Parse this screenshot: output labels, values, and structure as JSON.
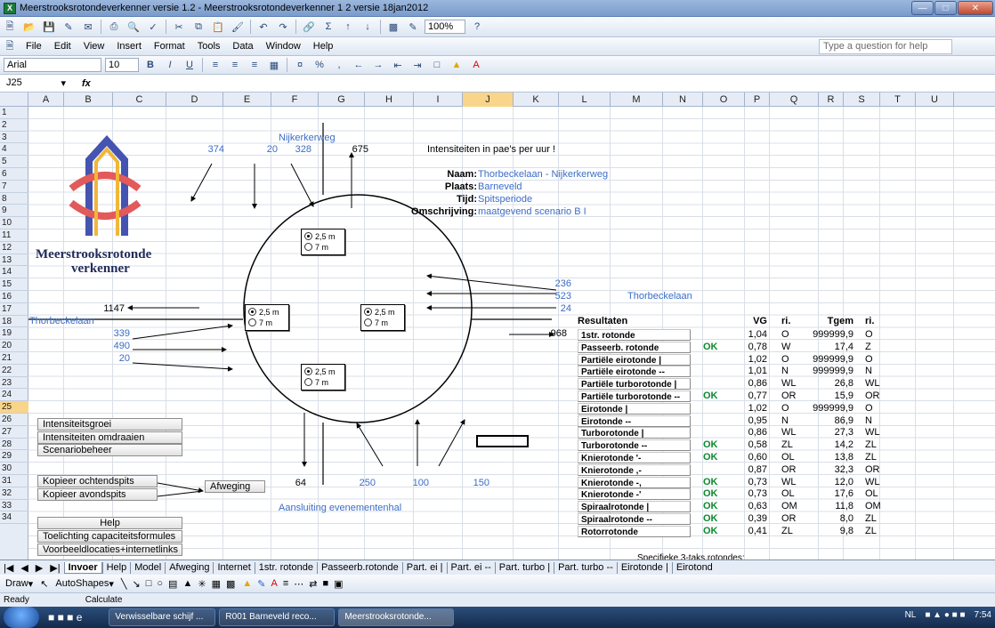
{
  "window": {
    "title": "Meerstrooksrotondeverkenner versie 1.2 - Meerstrooksrotondeverkenner 1 2 versie 18jan2012",
    "app_icon": "X"
  },
  "toolbar": {
    "zoom": "100%"
  },
  "menu": {
    "items": [
      "File",
      "Edit",
      "View",
      "Insert",
      "Format",
      "Tools",
      "Data",
      "Window",
      "Help"
    ],
    "help_placeholder": "Type a question for help"
  },
  "format": {
    "font": "Arial",
    "size": "10"
  },
  "formula": {
    "cell": "J25",
    "fx": "fx",
    "value": ""
  },
  "columns": [
    "A",
    "B",
    "C",
    "D",
    "E",
    "F",
    "G",
    "H",
    "I",
    "J",
    "K",
    "L",
    "M",
    "N",
    "O",
    "P",
    "Q",
    "R",
    "S",
    "T",
    "U"
  ],
  "rows": [
    "1",
    "2",
    "3",
    "4",
    "5",
    "6",
    "7",
    "8",
    "9",
    "10",
    "11",
    "12",
    "13",
    "14",
    "15",
    "16",
    "17",
    "18",
    "19",
    "20",
    "21",
    "22",
    "23",
    "24",
    "25",
    "26",
    "27",
    "28",
    "29",
    "30",
    "31",
    "32",
    "33",
    "34"
  ],
  "logo": {
    "line1": "Meerstrooksrotonde",
    "line2": "verkenner"
  },
  "north": {
    "road": "Nijkerkerweg",
    "v1": "374",
    "v2": "20",
    "v3": "328",
    "v4": "675"
  },
  "info": {
    "header": "Intensiteiten in pae's per uur !",
    "naam_label": "Naam:",
    "naam": "Thorbeckelaan - Nijkerkerweg",
    "plaats_label": "Plaats:",
    "plaats": "Barneveld",
    "tijd_label": "Tijd:",
    "tijd": "Spitsperiode",
    "omschr_label": "Omschrijving:",
    "omschr": "maatgevend scenario B I"
  },
  "east": {
    "road": "Thorbeckelaan",
    "v1": "236",
    "v2": "523",
    "v3": "24",
    "out": "968"
  },
  "west": {
    "road": "Thorbeckelaan",
    "out": "1147",
    "v1": "339",
    "v2": "490",
    "v3": "20"
  },
  "south": {
    "road": "Aansluiting evenementenhal",
    "out": "64",
    "v1": "250",
    "v2": "100",
    "v3": "150"
  },
  "radio": {
    "a": "2,5 m",
    "b": "7 m"
  },
  "buttons": {
    "groei": "Intensiteitsgroei",
    "omdraaien": "Intensiteiten omdraaien",
    "scenario": "Scenariobeheer",
    "ochtend": "Kopieer ochtendspits",
    "avond": "Kopieer avondspits",
    "afweging": "Afweging",
    "help": "Help",
    "toelichting": "Toelichting capaciteitsformules",
    "voorbeeld": "Voorbeeldlocaties+internetlinks"
  },
  "results": {
    "title": "Resultaten",
    "vg_hdr": "VG",
    "ri_hdr": "ri.",
    "tgem_hdr": "Tgem",
    "ri2_hdr": "ri.",
    "footer": "Specifieke 3-taks rotondes:",
    "rows": [
      {
        "name": "1str. rotonde",
        "ok": "",
        "vg": "1,04",
        "ri": "O",
        "tgem": "999999,9",
        "ri2": "O"
      },
      {
        "name": "Passeerb. rotonde",
        "ok": "OK",
        "vg": "0,78",
        "ri": "W",
        "tgem": "17,4",
        "ri2": "Z"
      },
      {
        "name": "Partiële eirotonde |",
        "ok": "",
        "vg": "1,02",
        "ri": "O",
        "tgem": "999999,9",
        "ri2": "O"
      },
      {
        "name": "Partiële eirotonde --",
        "ok": "",
        "vg": "1,01",
        "ri": "N",
        "tgem": "999999,9",
        "ri2": "N"
      },
      {
        "name": "Partiële turborotonde |",
        "ok": "",
        "vg": "0,86",
        "ri": "WL",
        "tgem": "26,8",
        "ri2": "WL"
      },
      {
        "name": "Partiële turborotonde --",
        "ok": "OK",
        "vg": "0,77",
        "ri": "OR",
        "tgem": "15,9",
        "ri2": "OR"
      },
      {
        "name": "Eirotonde       |",
        "ok": "",
        "vg": "1,02",
        "ri": "O",
        "tgem": "999999,9",
        "ri2": "O"
      },
      {
        "name": "Eirotonde       --",
        "ok": "",
        "vg": "0,95",
        "ri": "N",
        "tgem": "86,9",
        "ri2": "N"
      },
      {
        "name": "Turborotonde |",
        "ok": "",
        "vg": "0,86",
        "ri": "WL",
        "tgem": "27,3",
        "ri2": "WL"
      },
      {
        "name": "Turborotonde --",
        "ok": "OK",
        "vg": "0,58",
        "ri": "ZL",
        "tgem": "14,2",
        "ri2": "ZL"
      },
      {
        "name": "Knierotonde   '-",
        "ok": "OK",
        "vg": "0,60",
        "ri": "OL",
        "tgem": "13,8",
        "ri2": "ZL"
      },
      {
        "name": "Knierotonde   ,-",
        "ok": "",
        "vg": "0,87",
        "ri": "OR",
        "tgem": "32,3",
        "ri2": "OR"
      },
      {
        "name": "Knierotonde   -,",
        "ok": "OK",
        "vg": "0,73",
        "ri": "WL",
        "tgem": "12,0",
        "ri2": "WL"
      },
      {
        "name": "Knierotonde   -'",
        "ok": "OK",
        "vg": "0,73",
        "ri": "OL",
        "tgem": "17,6",
        "ri2": "OL"
      },
      {
        "name": "Spiraalrotonde |",
        "ok": "OK",
        "vg": "0,63",
        "ri": "OM",
        "tgem": "11,8",
        "ri2": "OM"
      },
      {
        "name": "Spiraalrotonde --",
        "ok": "OK",
        "vg": "0,39",
        "ri": "OR",
        "tgem": "8,0",
        "ri2": "ZL"
      },
      {
        "name": "Rotorrotonde",
        "ok": "OK",
        "vg": "0,41",
        "ri": "ZL",
        "tgem": "9,8",
        "ri2": "ZL"
      }
    ]
  },
  "tabs": [
    "Invoer",
    "Help",
    "Model",
    "Afweging",
    "Internet",
    "1str. rotonde",
    "Passeerb.rotonde",
    "Part. ei |",
    "Part. ei --",
    "Part. turbo |",
    "Part. turbo --",
    "Eirotonde |",
    "Eirotond"
  ],
  "drawbar": {
    "draw": "Draw",
    "autoshapes": "AutoShapes"
  },
  "status": {
    "left": "Ready",
    "mid": "Calculate"
  },
  "taskbar": {
    "items": [
      "Verwisselbare schijf ...",
      "R001 Barneveld reco...",
      "Meerstrooksrotonde..."
    ],
    "lang": "NL",
    "time": "7:54"
  }
}
